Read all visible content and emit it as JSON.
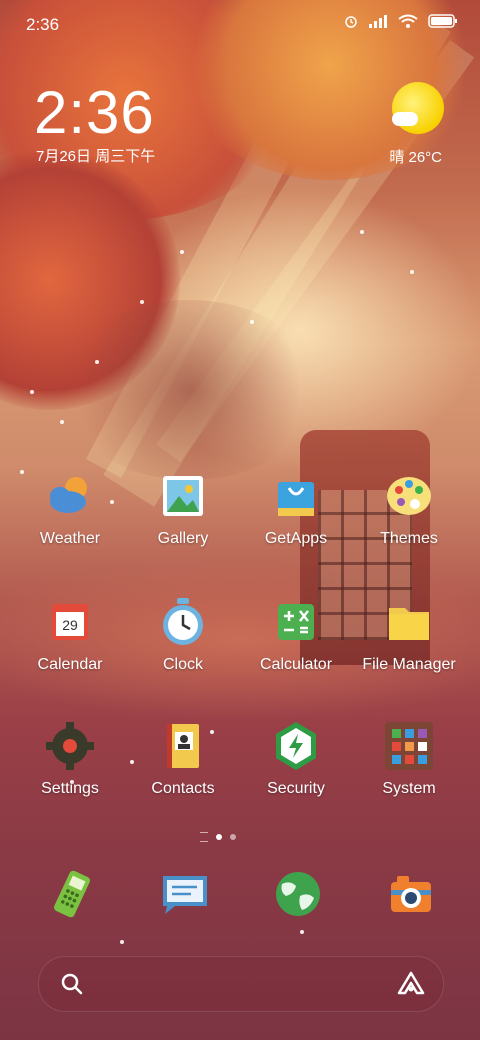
{
  "status_bar": {
    "time": "2:36"
  },
  "clock_widget": {
    "time": "2:36",
    "date": "7月26日 周三下午"
  },
  "weather_widget": {
    "text": "晴 26°C",
    "icon": "sunny-cloud-icon"
  },
  "apps": [
    {
      "id": "weather",
      "label": "Weather",
      "icon": "weather-icon"
    },
    {
      "id": "gallery",
      "label": "Gallery",
      "icon": "gallery-icon"
    },
    {
      "id": "getapps",
      "label": "GetApps",
      "icon": "shopping-bag-icon"
    },
    {
      "id": "themes",
      "label": "Themes",
      "icon": "palette-icon"
    },
    {
      "id": "calendar",
      "label": "Calendar",
      "icon": "calendar-icon",
      "day": "29"
    },
    {
      "id": "clock",
      "label": "Clock",
      "icon": "clock-icon"
    },
    {
      "id": "calculator",
      "label": "Calculator",
      "icon": "calculator-icon"
    },
    {
      "id": "file_manager",
      "label": "File Manager",
      "icon": "folder-icon"
    },
    {
      "id": "settings",
      "label": "Settings",
      "icon": "gear-icon"
    },
    {
      "id": "contacts",
      "label": "Contacts",
      "icon": "contacts-book-icon"
    },
    {
      "id": "security",
      "label": "Security",
      "icon": "shield-bolt-icon"
    },
    {
      "id": "system",
      "label": "System",
      "icon": "folder-grid-icon"
    }
  ],
  "page_indicator": {
    "pages": 2,
    "active": 1
  },
  "dock": [
    {
      "id": "phone",
      "icon": "phone-icon"
    },
    {
      "id": "messaging",
      "icon": "message-icon"
    },
    {
      "id": "browser",
      "icon": "globe-icon"
    },
    {
      "id": "camera",
      "icon": "camera-icon"
    }
  ],
  "search_bar": {
    "left_icon": "search-icon",
    "right_icon": "assistant-icon"
  },
  "colors": {
    "sun": "#f8d100",
    "booth": "#a94a3a",
    "bg_bottom": "#7c3443"
  }
}
